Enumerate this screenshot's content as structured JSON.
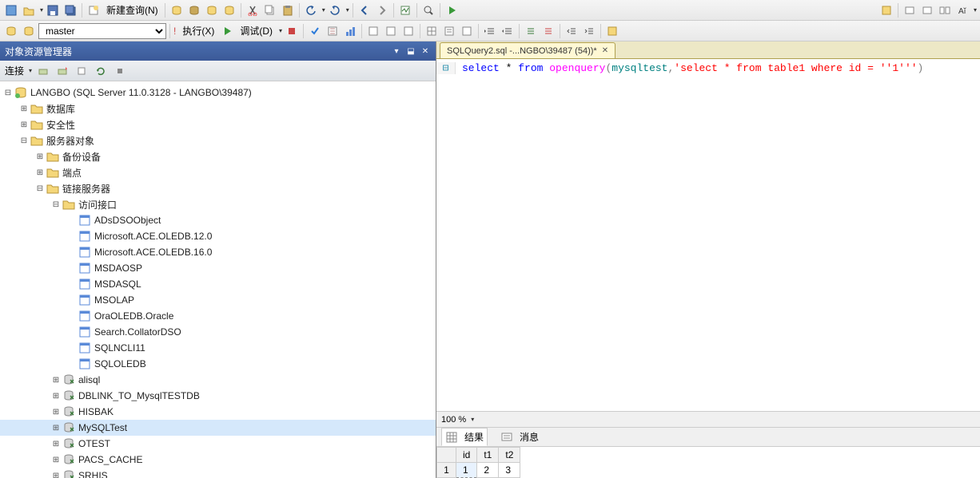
{
  "toolbar1": {
    "new_query": "新建查询(N)"
  },
  "toolbar2": {
    "db_select": "master",
    "execute": "执行(X)",
    "debug": "调试(D)"
  },
  "explorer": {
    "title": "对象资源管理器",
    "connect_label": "连接",
    "root": "LANGBO (SQL Server 11.0.3128 - LANGBO\\39487)",
    "folders": {
      "databases": "数据库",
      "security": "安全性",
      "server_objects": "服务器对象",
      "backup_devices": "备份设备",
      "endpoints": "端点",
      "linked_servers": "链接服务器",
      "providers": "访问接口"
    },
    "providers": [
      "ADsDSOObject",
      "Microsoft.ACE.OLEDB.12.0",
      "Microsoft.ACE.OLEDB.16.0",
      "MSDAOSP",
      "MSDASQL",
      "MSOLAP",
      "OraOLEDB.Oracle",
      "Search.CollatorDSO",
      "SQLNCLI11",
      "SQLOLEDB"
    ],
    "linked": [
      "alisql",
      "DBLINK_TO_MysqlTESTDB",
      "HISBAK",
      "MySQLTest",
      "OTEST",
      "PACS_CACHE",
      "SRHIS"
    ]
  },
  "editor": {
    "tab_title": "SQLQuery2.sql -...NGBO\\39487 (54))*",
    "sql": {
      "p1": "select",
      "p2": " * ",
      "p3": "from",
      "p4": " openquery",
      "p5": "(",
      "p6": "mysqltest",
      "p7": ",",
      "p8": "'select * from table1 where id = ''1'''",
      "p9": ")"
    },
    "zoom": "100 %"
  },
  "results": {
    "tab_results": "结果",
    "tab_messages": "消息",
    "headers": [
      "id",
      "t1",
      "t2"
    ],
    "rows": [
      {
        "n": "1",
        "cells": [
          "1",
          "2",
          "3"
        ]
      }
    ]
  }
}
